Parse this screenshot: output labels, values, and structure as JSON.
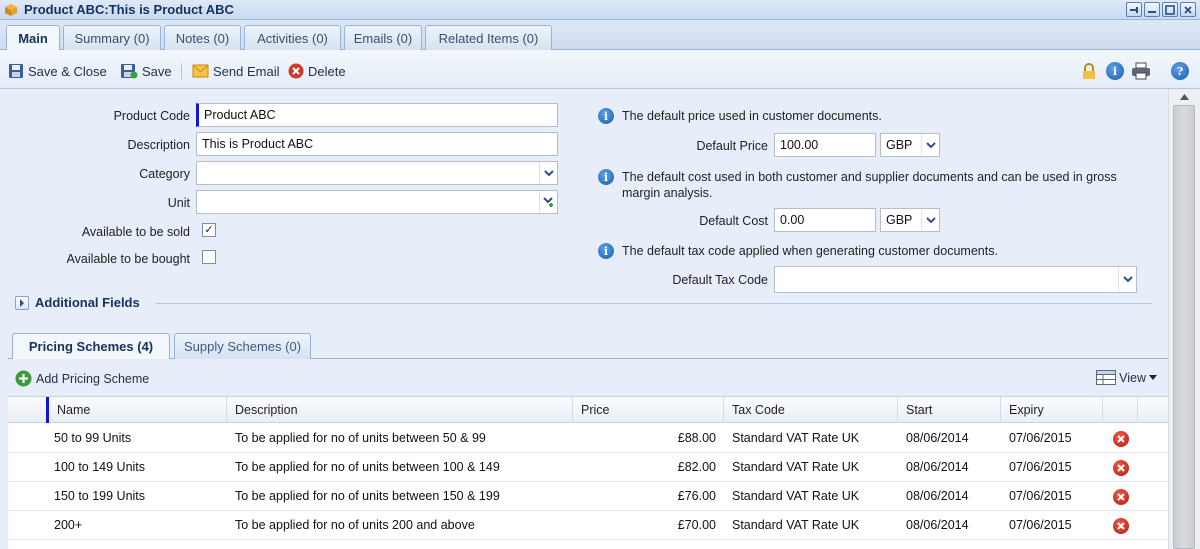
{
  "window": {
    "title": "Product ABC:This is Product ABC"
  },
  "tabs": [
    {
      "label": "Main"
    },
    {
      "label": "Summary (0)"
    },
    {
      "label": "Notes (0)"
    },
    {
      "label": "Activities (0)"
    },
    {
      "label": "Emails (0)"
    },
    {
      "label": "Related Items (0)"
    }
  ],
  "toolbar": {
    "save_close": "Save & Close",
    "save": "Save",
    "send_email": "Send Email",
    "delete": "Delete"
  },
  "form": {
    "product_code": {
      "label": "Product Code",
      "value": "Product ABC"
    },
    "description": {
      "label": "Description",
      "value": "This is Product ABC"
    },
    "category": {
      "label": "Category",
      "value": ""
    },
    "unit": {
      "label": "Unit",
      "value": ""
    },
    "available_sold": {
      "label": "Available to be sold",
      "checked": true
    },
    "available_bought": {
      "label": "Available to be bought",
      "checked": false
    },
    "price_info": "The default price used in customer documents.",
    "default_price": {
      "label": "Default Price",
      "value": "100.00",
      "currency": "GBP"
    },
    "cost_info_1": "The default cost used in both customer and supplier documents and can be used in gross",
    "cost_info_2": "margin analysis.",
    "default_cost": {
      "label": "Default Cost",
      "value": "0.00",
      "currency": "GBP"
    },
    "tax_info": "The default tax code applied when generating customer documents.",
    "default_tax_code": {
      "label": "Default Tax Code",
      "value": ""
    }
  },
  "additional_fields": {
    "label": "Additional Fields"
  },
  "subtabs": [
    {
      "label": "Pricing Schemes (4)"
    },
    {
      "label": "Supply Schemes (0)"
    }
  ],
  "grid_tools": {
    "add_label": "Add Pricing Scheme",
    "view_label": "View"
  },
  "grid": {
    "columns": [
      "Name",
      "Description",
      "Price",
      "Tax Code",
      "Start",
      "Expiry"
    ],
    "rows": [
      {
        "name": "50 to 99 Units",
        "description": "To be applied for no of units between 50 & 99",
        "price": "£88.00",
        "tax_code": "Standard VAT Rate UK",
        "start": "08/06/2014",
        "expiry": "07/06/2015"
      },
      {
        "name": "100 to 149 Units",
        "description": "To be applied for no of units between 100 & 149",
        "price": "£82.00",
        "tax_code": "Standard VAT Rate UK",
        "start": "08/06/2014",
        "expiry": "07/06/2015"
      },
      {
        "name": "150 to 199 Units",
        "description": "To be applied for no of units between 150 & 199",
        "price": "£76.00",
        "tax_code": "Standard VAT Rate UK",
        "start": "08/06/2014",
        "expiry": "07/06/2015"
      },
      {
        "name": "200+",
        "description": "To be applied for no of units 200 and above",
        "price": "£70.00",
        "tax_code": "Standard VAT Rate UK",
        "start": "08/06/2014",
        "expiry": "07/06/2015"
      }
    ]
  },
  "icons": {
    "window": "product-box-icon",
    "save_close": "floppy-disk-icon",
    "save": "floppy-disk-icon",
    "send_email": "envelope-icon",
    "delete": "delete-circle-icon",
    "lock": "lock-icon",
    "info": "info-icon",
    "print": "printer-icon",
    "help": "help-icon"
  },
  "colors": {
    "accent": "#15315e",
    "required_marker": "#1515d6",
    "delete_red": "#c42718"
  }
}
